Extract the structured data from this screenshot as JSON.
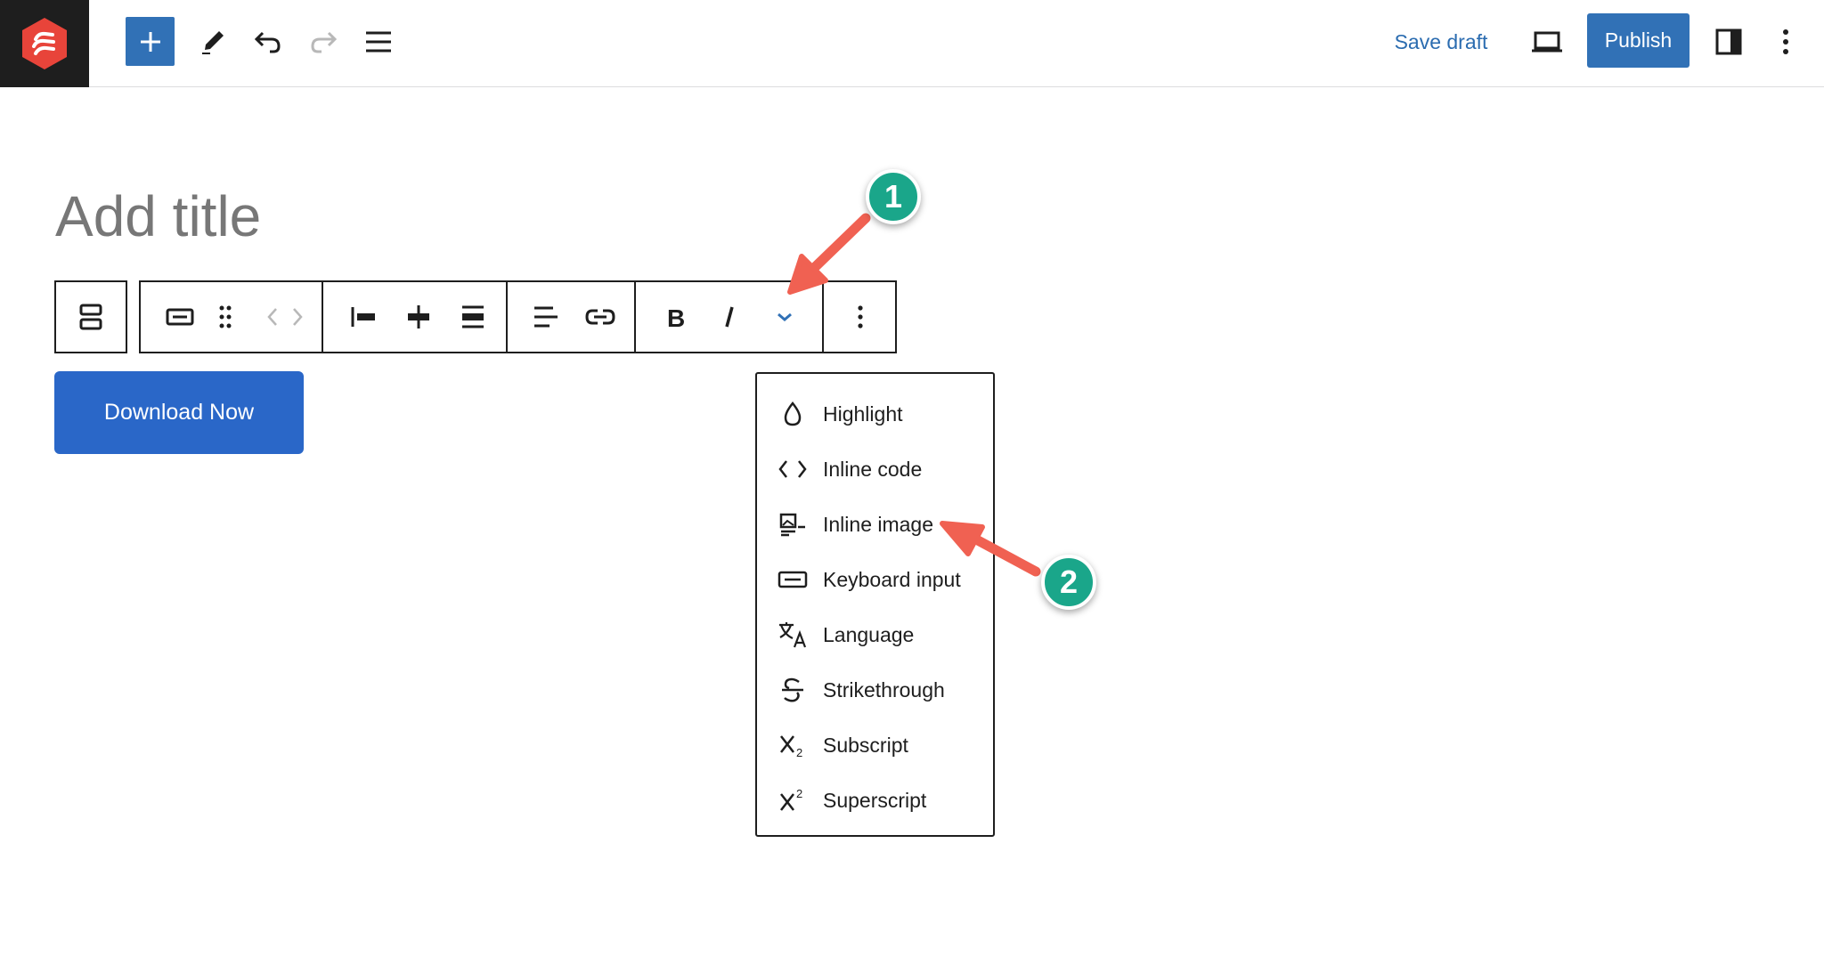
{
  "topbar": {
    "logo_icon": "brand-logo-icon",
    "add_icon": "plus-icon",
    "tools_icon": "pencil-icon",
    "undo_icon": "undo-icon",
    "redo_icon": "redo-icon",
    "list_view_icon": "list-view-icon",
    "save_draft_label": "Save draft",
    "preview_icon": "laptop-icon",
    "publish_label": "Publish",
    "settings_icon": "sidebar-icon",
    "options_icon": "kebab-icon"
  },
  "editor": {
    "title_placeholder": "Add title"
  },
  "block_toolbar": {
    "parent_icon": "parent-block-icon",
    "block_type_icon": "button-block-icon",
    "drag_icon": "drag-handle-icon",
    "move_icon": "move-arrows-icon",
    "justify_icons": [
      "justify-left-icon",
      "justify-center-icon",
      "justify-space-between-icon"
    ],
    "align_icon": "align-left-icon",
    "link_icon": "link-icon",
    "bold_icon": "bold-icon",
    "italic_icon": "italic-icon",
    "more_formats_icon": "chevron-down-icon",
    "options_icon": "kebab-icon"
  },
  "button_block": {
    "label": "Download Now"
  },
  "format_menu": {
    "items": [
      {
        "label": "Highlight",
        "icon": "droplet-icon"
      },
      {
        "label": "Inline code",
        "icon": "code-icon"
      },
      {
        "label": "Inline image",
        "icon": "image-icon"
      },
      {
        "label": "Keyboard input",
        "icon": "keyboard-icon"
      },
      {
        "label": "Language",
        "icon": "language-icon"
      },
      {
        "label": "Strikethrough",
        "icon": "strikethrough-icon"
      },
      {
        "label": "Subscript",
        "icon": "subscript-icon"
      },
      {
        "label": "Superscript",
        "icon": "superscript-icon"
      }
    ]
  },
  "annotations": {
    "badge_1": "1",
    "badge_2": "2",
    "badge_color": "#1aa68a",
    "arrow_color": "#f06152"
  },
  "colors": {
    "accent": "#3171b6",
    "button_bg": "#2a67c8"
  }
}
